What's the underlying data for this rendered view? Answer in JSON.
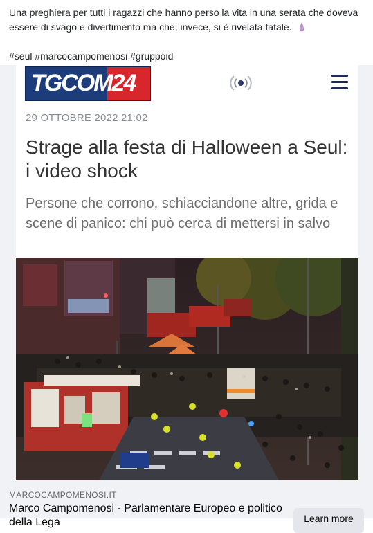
{
  "post": {
    "text": "Una preghiera per tutti i ragazzi che hanno perso la vita in una serata che doveva essere di svago e divertimento ma che, invece, si è rivelata fatale.",
    "emoji": "praying-hands",
    "hashtags": [
      "#seul",
      "#marcocampomenosi",
      "#gruppoid"
    ]
  },
  "article": {
    "logo": "TGCOM24",
    "date": "29 OTTOBRE 2022  21:02",
    "title": "Strage alla festa di Halloween a Seul: i video shock",
    "subtitle": "Persone che corrono, schiacciandone altre, grida e scene di panico: chi può cerca di mettersi in salvo"
  },
  "link": {
    "domain": "MARCOCAMPOMENOSI.IT",
    "title": "Marco Campomenosi - Parlamentare Europeo e politico della Lega",
    "cta": "Learn more"
  },
  "colors": {
    "brand_blue": "#1d3d7a",
    "brand_red": "#d7262c",
    "card_bg": "#f0f2f5"
  }
}
